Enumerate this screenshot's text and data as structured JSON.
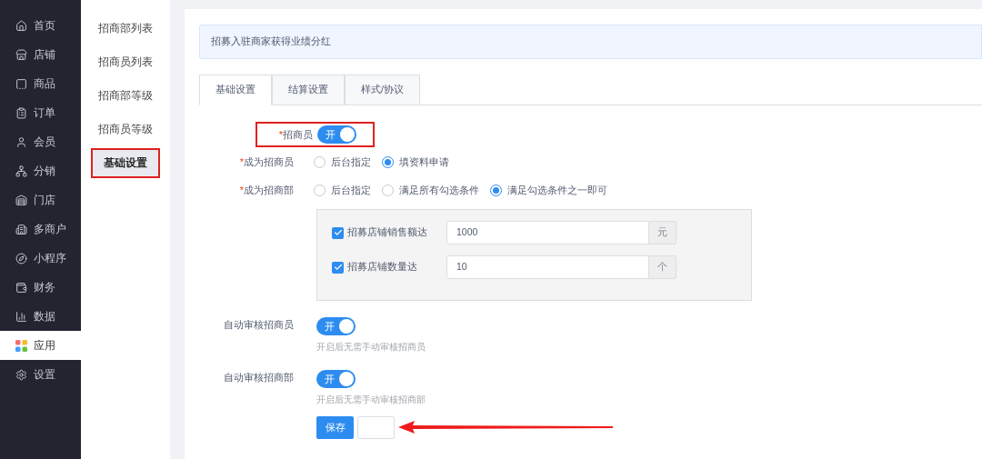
{
  "nav": {
    "items": [
      {
        "label": "首页",
        "selected": false
      },
      {
        "label": "店铺",
        "selected": false
      },
      {
        "label": "商品",
        "selected": false
      },
      {
        "label": "订单",
        "selected": false
      },
      {
        "label": "会员",
        "selected": false
      },
      {
        "label": "分销",
        "selected": false
      },
      {
        "label": "门店",
        "selected": false
      },
      {
        "label": "多商户",
        "selected": false
      },
      {
        "label": "小程序",
        "selected": false
      },
      {
        "label": "财务",
        "selected": false
      },
      {
        "label": "数据",
        "selected": false
      },
      {
        "label": "应用",
        "selected": true
      },
      {
        "label": "设置",
        "selected": false
      }
    ]
  },
  "submenu": {
    "items": [
      {
        "label": "招商部列表",
        "selected": false
      },
      {
        "label": "招商员列表",
        "selected": false
      },
      {
        "label": "招商部等级",
        "selected": false
      },
      {
        "label": "招商员等级",
        "selected": false
      },
      {
        "label": "基础设置",
        "selected": true
      }
    ]
  },
  "notice": "招募入驻商家获得业绩分红",
  "tabs": [
    {
      "label": "基础设置",
      "selected": true
    },
    {
      "label": "结算设置",
      "selected": false
    },
    {
      "label": "样式/协议",
      "selected": false
    }
  ],
  "form": {
    "recruiter_switch": {
      "label": "招商员",
      "required_mark": "*",
      "on": true,
      "text": "开"
    },
    "radio_groups": [
      {
        "label": "成为招商员",
        "required_mark": "*",
        "options": [
          {
            "label": "后台指定",
            "selected": false
          },
          {
            "label": "填资料申请",
            "selected": true
          }
        ]
      },
      {
        "label": "成为招商部",
        "required_mark": "*",
        "options": [
          {
            "label": "后台指定",
            "selected": false
          },
          {
            "label": "满足所有勾选条件",
            "selected": false
          },
          {
            "label": "满足勾选条件之一即可",
            "selected": true
          }
        ]
      }
    ],
    "conditions": [
      {
        "label": "招募店铺销售额达",
        "checked": true,
        "value": "1000",
        "unit": "元"
      },
      {
        "label": "招募店铺数量达",
        "checked": true,
        "value": "10",
        "unit": "个"
      }
    ],
    "auto_switches": [
      {
        "label": "自动审核招商员",
        "on": true,
        "text": "开",
        "hint": "开启后无需手动审核招商员"
      },
      {
        "label": "自动审核招商部",
        "on": true,
        "text": "开",
        "hint": "开启后无需手动审核招商部"
      }
    ],
    "save_button": "保存"
  }
}
